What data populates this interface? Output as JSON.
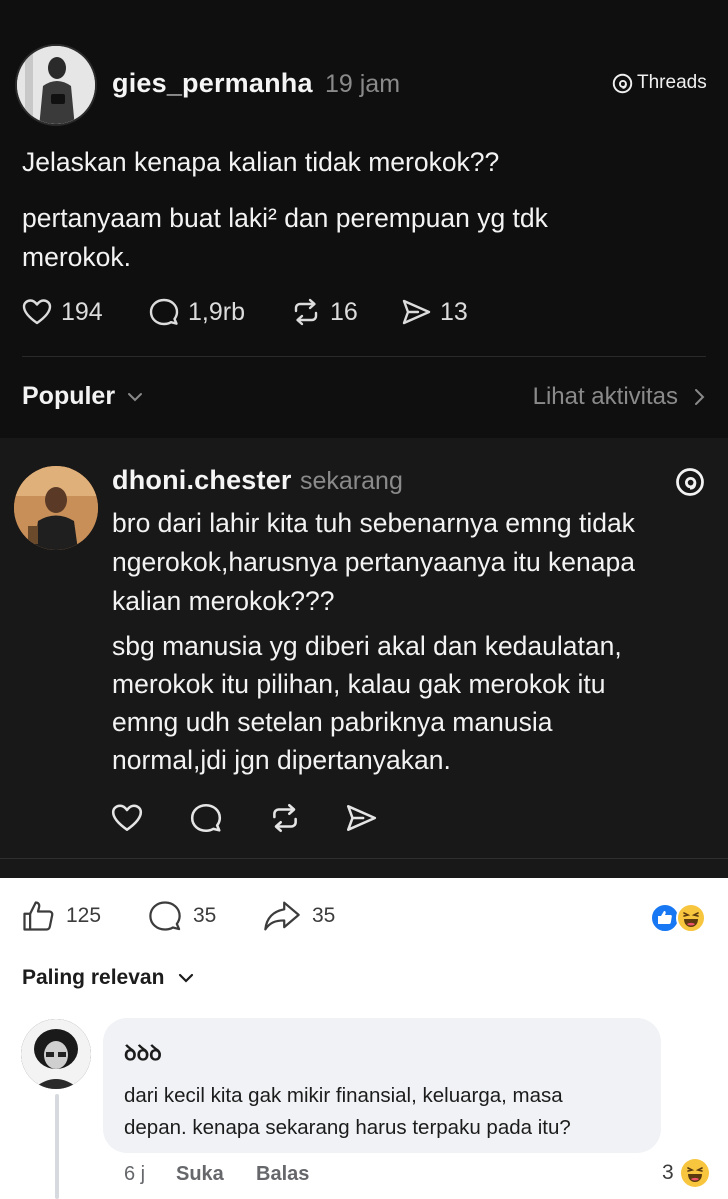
{
  "post": {
    "username": "gies_permanha",
    "time": "19 jam",
    "brand": "Threads",
    "title_line": "Jelaskan kenapa kalian tidak merokok??",
    "body_lines": [
      "pertanyaam buat laki² dan perempuan yg tdk",
      "merokok."
    ],
    "stats": {
      "likes": "194",
      "comments": "1,9rb",
      "reposts": "16",
      "shares": "13"
    }
  },
  "filter": {
    "sort_label": "Populer",
    "activity_link": "Lihat aktivitas"
  },
  "reply": {
    "username": "dhoni.chester",
    "time": "sekarang",
    "paragraph1": [
      "bro dari lahir kita tuh sebenarnya emng tidak",
      "ngerokok,harusnya pertanyaanya itu kenapa",
      "kalian merokok???"
    ],
    "paragraph2": [
      "sbg manusia yg diberi akal dan kedaulatan,",
      "merokok itu pilihan, kalau gak merokok itu",
      "emng udh setelan pabriknya manusia",
      "normal,jdi jgn dipertanyakan."
    ]
  },
  "facebook": {
    "likes": "125",
    "comments": "35",
    "shares": "35",
    "sort_label": "Paling relevan",
    "comment": {
      "author": "ꝺꝺꝺ",
      "lines": [
        "dari kecil kita gak mikir finansial, keluarga, masa",
        "depan. kenapa sekarang harus terpaku pada itu?"
      ],
      "age": "6 j",
      "like_label": "Suka",
      "reply_label": "Balas",
      "reaction_count": "3"
    }
  }
}
